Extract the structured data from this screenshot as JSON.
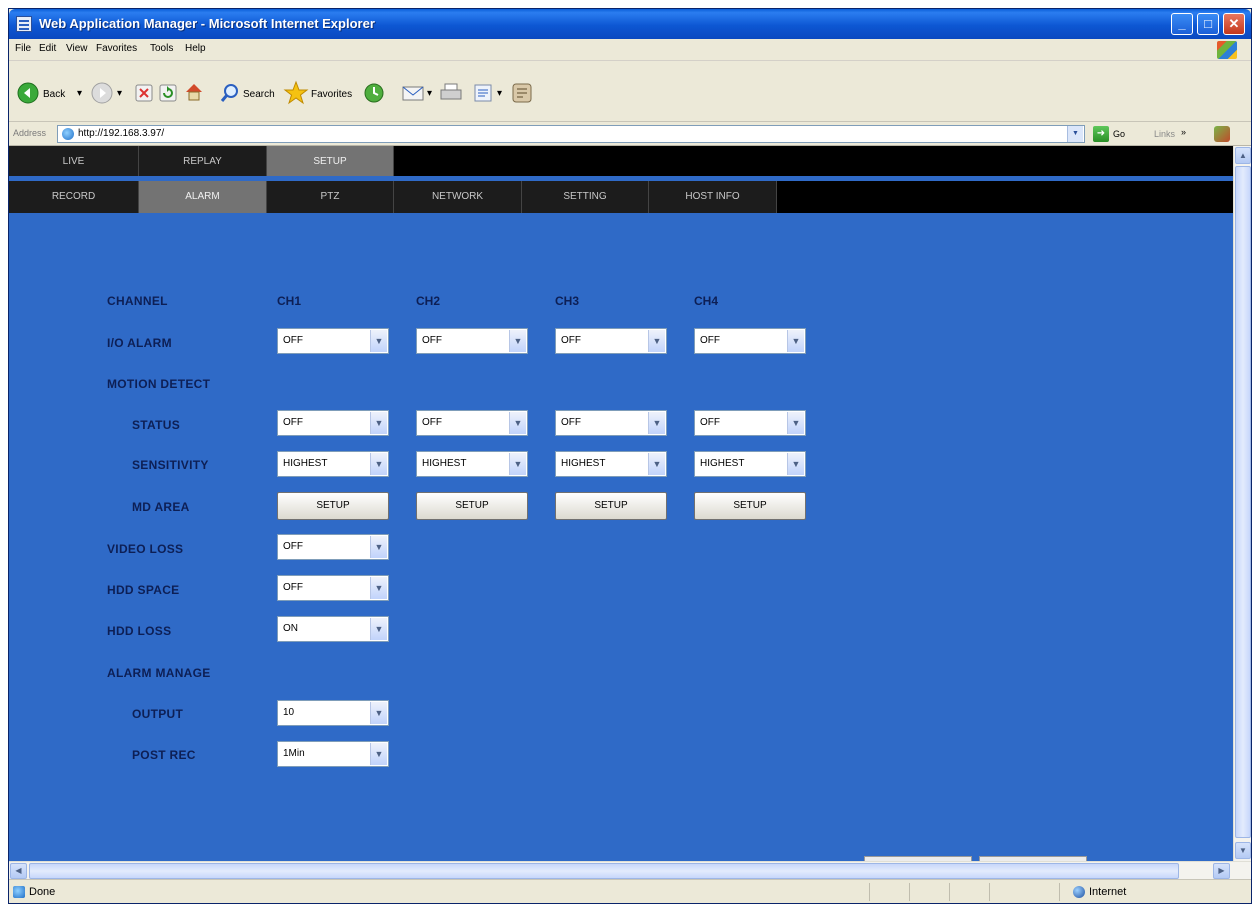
{
  "window": {
    "title": "Web Application Manager - Microsoft Internet Explorer",
    "controls": {
      "minimize": "_",
      "maximize": "□",
      "close": "✕"
    }
  },
  "menubar": {
    "items": [
      "File",
      "Edit",
      "View",
      "Favorites",
      "Tools",
      "Help"
    ]
  },
  "toolbar": {
    "back_label": "Back",
    "search_label": "Search",
    "favorites_label": "Favorites"
  },
  "addressbar": {
    "label": "Address",
    "url": "http://192.168.3.97/",
    "go_label": "Go",
    "links_label": "Links",
    "links_chevron": "»"
  },
  "app": {
    "top_tabs": [
      {
        "label": "LIVE",
        "active": false
      },
      {
        "label": "REPLAY",
        "active": false
      },
      {
        "label": "SETUP",
        "active": true
      }
    ],
    "sub_tabs": [
      {
        "label": "RECORD",
        "active": false
      },
      {
        "label": "ALARM",
        "active": true
      },
      {
        "label": "PTZ",
        "active": false
      },
      {
        "label": "NETWORK",
        "active": false
      },
      {
        "label": "SETTING",
        "active": false
      },
      {
        "label": "HOST INFO",
        "active": false
      }
    ],
    "alarm": {
      "labels": {
        "channel": "CHANNEL",
        "io_alarm": "I/O ALARM",
        "motion_detect": "MOTION DETECT",
        "status": "STATUS",
        "sensitivity": "SENSITIVITY",
        "md_area": "MD AREA",
        "video_loss": "VIDEO LOSS",
        "hdd_space": "HDD SPACE",
        "hdd_loss": "HDD LOSS",
        "alarm_manage": "ALARM MANAGE",
        "output": "OUTPUT",
        "post_rec": "POST REC"
      },
      "channels": [
        "CH1",
        "CH2",
        "CH3",
        "CH4"
      ],
      "io_alarm_values": [
        "OFF",
        "OFF",
        "OFF",
        "OFF"
      ],
      "status_values": [
        "OFF",
        "OFF",
        "OFF",
        "OFF"
      ],
      "sensitivity_values": [
        "HIGHEST",
        "HIGHEST",
        "HIGHEST",
        "HIGHEST"
      ],
      "md_area_button": "SETUP",
      "video_loss_value": "OFF",
      "hdd_space_value": "OFF",
      "hdd_loss_value": "ON",
      "output_value": "10",
      "post_rec_value": "1Min"
    }
  },
  "scroll": {
    "up": "▲",
    "down": "▼",
    "left": "◀",
    "right": "▶"
  },
  "dropdown_arrow": "▼",
  "statusbar": {
    "text": "Done",
    "zone": "Internet"
  },
  "colors": {
    "content_bg": "#2f6ac7",
    "label_text": "#0d1f55",
    "nav_bg": "#000000",
    "tab_active": "#737373"
  }
}
